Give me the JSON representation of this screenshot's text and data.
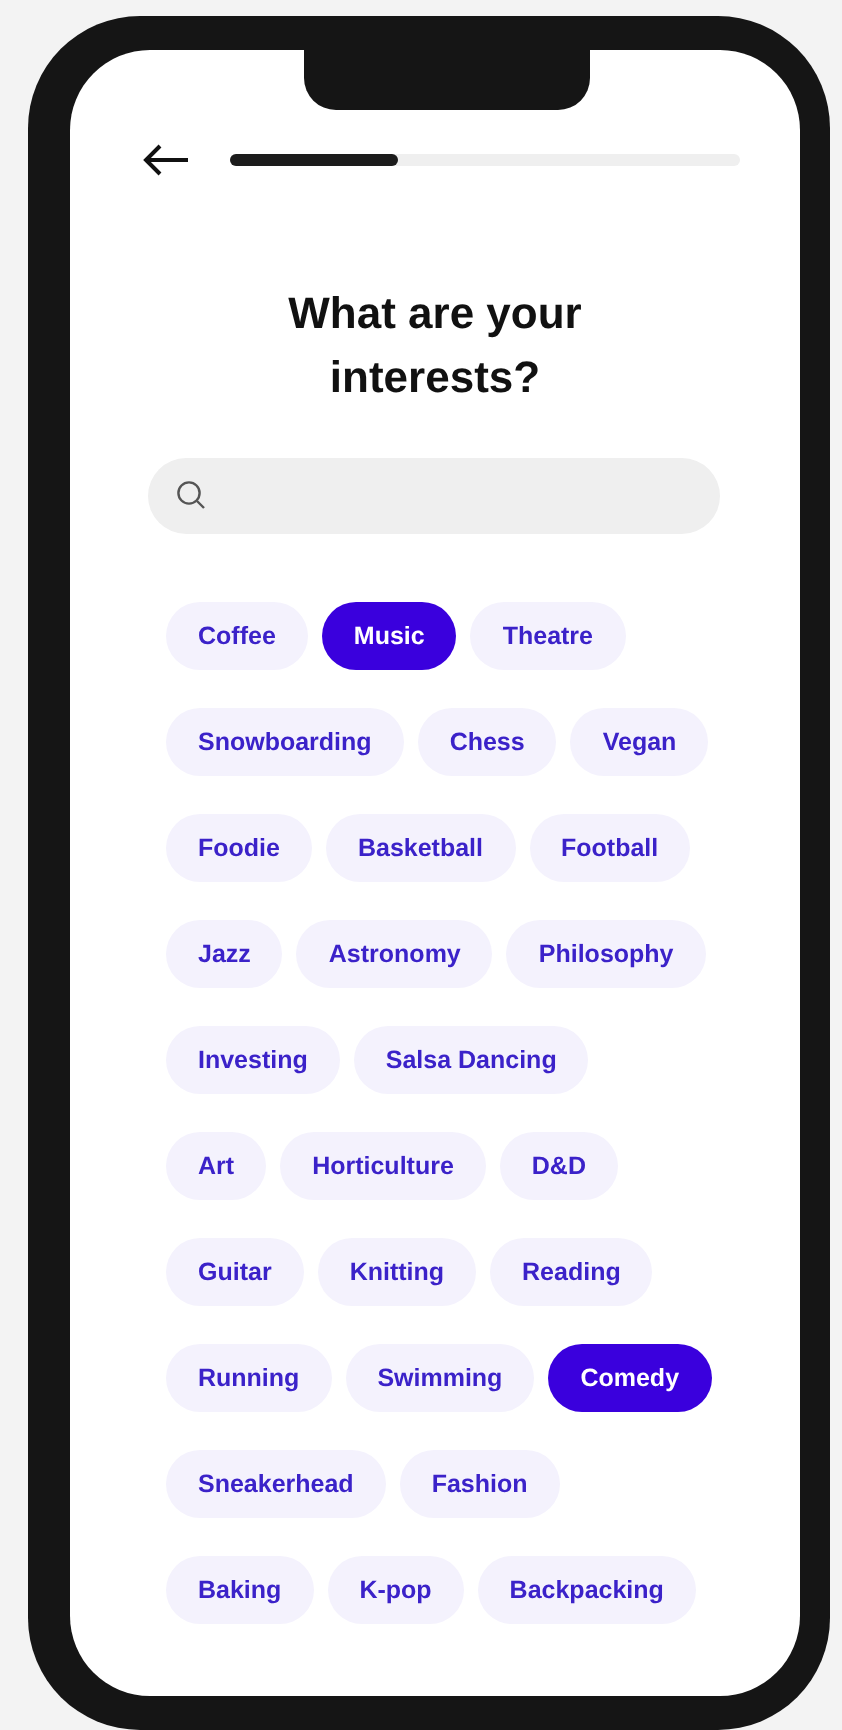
{
  "progress": {
    "level": 0.33
  },
  "title": "What are your interests?",
  "interest_rows": [
    {
      "chips": [
        {
          "label": "Coffee",
          "selected": false
        },
        {
          "label": "Music",
          "selected": true
        },
        {
          "label": "Theatre",
          "selected": false
        }
      ]
    },
    {
      "chips": [
        {
          "label": "Snowboarding",
          "selected": false
        },
        {
          "label": "Chess",
          "selected": false
        },
        {
          "label": "Vegan",
          "selected": false
        }
      ]
    },
    {
      "chips": [
        {
          "label": "Foodie",
          "selected": false
        },
        {
          "label": "Basketball",
          "selected": false
        },
        {
          "label": "Football",
          "selected": false
        }
      ]
    },
    {
      "chips": [
        {
          "label": "Jazz",
          "selected": false
        },
        {
          "label": "Astronomy",
          "selected": false
        },
        {
          "label": "Philosophy",
          "selected": false
        }
      ]
    },
    {
      "chips": [
        {
          "label": "Investing",
          "selected": false
        },
        {
          "label": "Salsa Dancing",
          "selected": false
        }
      ]
    },
    {
      "chips": [
        {
          "label": "Art",
          "selected": false
        },
        {
          "label": "Horticulture",
          "selected": false
        },
        {
          "label": "D&D",
          "selected": false
        }
      ]
    },
    {
      "chips": [
        {
          "label": "Guitar",
          "selected": false
        },
        {
          "label": "Knitting",
          "selected": false
        },
        {
          "label": "Reading",
          "selected": false
        }
      ]
    },
    {
      "chips": [
        {
          "label": "Running",
          "selected": false
        },
        {
          "label": "Swimming",
          "selected": false
        },
        {
          "label": "Comedy",
          "selected": true
        }
      ]
    },
    {
      "chips": [
        {
          "label": "Sneakerhead",
          "selected": false
        },
        {
          "label": "Fashion",
          "selected": false
        }
      ]
    },
    {
      "chips": [
        {
          "label": "Baking",
          "selected": false
        },
        {
          "label": "K-pop",
          "selected": false
        },
        {
          "label": "Backpacking",
          "selected": false
        }
      ]
    }
  ]
}
